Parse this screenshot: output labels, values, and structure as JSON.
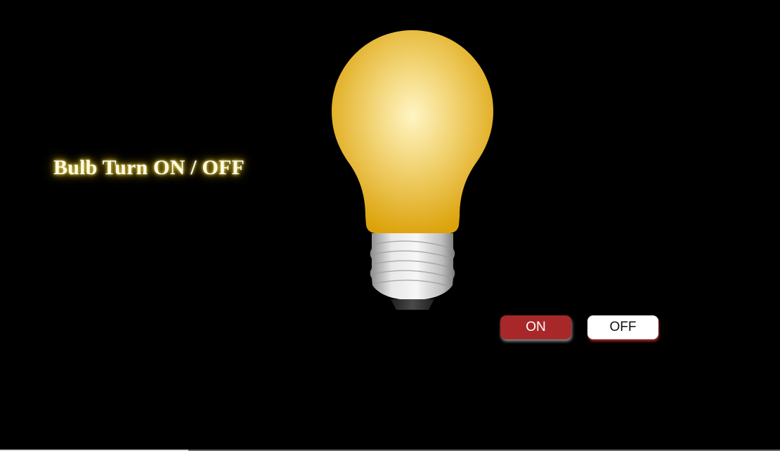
{
  "page": {
    "title": "Bulb Turn ON / OFF"
  },
  "bulb": {
    "state": "on",
    "glass_color": "#e3a80e",
    "glass_highlight": "#fff3bf",
    "base_color": "#c9c9c9",
    "tip_color": "#333333"
  },
  "controls": {
    "on_label": "ON",
    "off_label": "OFF",
    "on_color": "#a8282a",
    "off_color": "#ffffff"
  }
}
